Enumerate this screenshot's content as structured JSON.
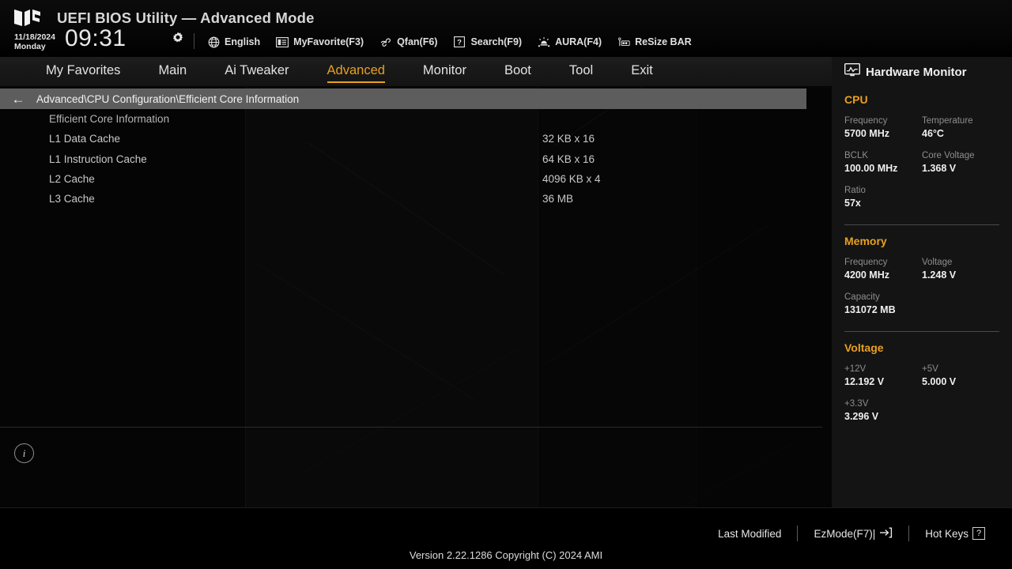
{
  "header": {
    "logo_icon": "tuf-gaming-logo",
    "title": "UEFI BIOS Utility — Advanced Mode",
    "date": "11/18/2024",
    "weekday": "Monday",
    "time": "09:31",
    "settings_icon": "gear-icon",
    "toolbar": [
      {
        "label": "English",
        "icon": "globe-icon"
      },
      {
        "label": "MyFavorite(F3)",
        "icon": "list-card-icon"
      },
      {
        "label": "Qfan(F6)",
        "icon": "fan-icon"
      },
      {
        "label": "Search(F9)",
        "icon": "question-box-icon"
      },
      {
        "label": "AURA(F4)",
        "icon": "aura-light-icon"
      },
      {
        "label": "ReSize BAR",
        "icon": "resize-bar-icon"
      }
    ]
  },
  "nav": {
    "active": "Advanced",
    "tabs": [
      {
        "label": "My Favorites"
      },
      {
        "label": "Main"
      },
      {
        "label": "Ai Tweaker"
      },
      {
        "label": "Advanced"
      },
      {
        "label": "Monitor"
      },
      {
        "label": "Boot"
      },
      {
        "label": "Tool"
      },
      {
        "label": "Exit"
      }
    ]
  },
  "breadcrumb": {
    "back_icon": "arrow-left-icon",
    "path": "Advanced\\CPU Configuration\\Efficient Core Information"
  },
  "main": {
    "section_title": "Efficient Core Information",
    "rows": [
      {
        "label": "L1 Data Cache",
        "value": "32 KB x 16"
      },
      {
        "label": "L1 Instruction Cache",
        "value": "64 KB x 16"
      },
      {
        "label": "L2 Cache",
        "value": "4096 KB x 4"
      },
      {
        "label": "L3 Cache",
        "value": "36 MB"
      }
    ],
    "info_icon": "info-icon"
  },
  "hardware_monitor": {
    "icon": "monitor-waveform-icon",
    "title": "Hardware Monitor",
    "groups": [
      {
        "name": "CPU",
        "pairs": [
          [
            {
              "key": "Frequency",
              "value": "5700 MHz"
            },
            {
              "key": "Temperature",
              "value": "46°C"
            }
          ],
          [
            {
              "key": "BCLK",
              "value": "100.00 MHz"
            },
            {
              "key": "Core Voltage",
              "value": "1.368 V"
            }
          ],
          [
            {
              "key": "Ratio",
              "value": "57x"
            }
          ]
        ]
      },
      {
        "name": "Memory",
        "pairs": [
          [
            {
              "key": "Frequency",
              "value": "4200 MHz"
            },
            {
              "key": "Voltage",
              "value": "1.248 V"
            }
          ],
          [
            {
              "key": "Capacity",
              "value": "131072 MB"
            }
          ]
        ]
      },
      {
        "name": "Voltage",
        "pairs": [
          [
            {
              "key": "+12V",
              "value": "12.192 V"
            },
            {
              "key": "+5V",
              "value": "5.000 V"
            }
          ],
          [
            {
              "key": "+3.3V",
              "value": "3.296 V"
            }
          ]
        ]
      }
    ]
  },
  "footer": {
    "last_modified": "Last Modified",
    "ezmode": "EzMode(F7)|",
    "ezmode_icon": "arrow-into-bracket-icon",
    "hotkeys": "Hot Keys",
    "hotkeys_key": "?",
    "version": "Version 2.22.1286 Copyright (C) 2024 AMI"
  },
  "colors": {
    "accent": "#e8a020",
    "breadcrumb_bg": "#5d5d5d",
    "panel_bg": "#141414",
    "text": "#c9c9c9"
  }
}
